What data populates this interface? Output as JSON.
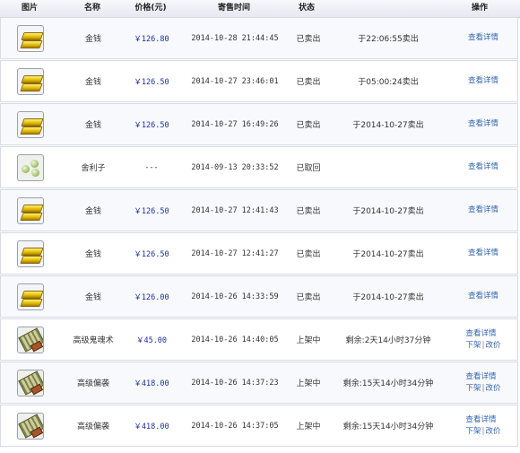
{
  "header": {
    "image": "图片",
    "name": "名称",
    "price": "价格(元)",
    "time": "寄售时间",
    "status": "状态",
    "ops": "操作"
  },
  "rows": [
    {
      "icon": "gold-ingot-icon",
      "name": "金钱",
      "price": "￥126.80",
      "time": "2014-10-28 21:44:45",
      "status": "已卖出",
      "desc": "于22:06:55卖出",
      "ops": [
        "查看详情"
      ]
    },
    {
      "icon": "gold-ingot-icon",
      "name": "金钱",
      "price": "￥126.50",
      "time": "2014-10-27 23:46:01",
      "status": "已卖出",
      "desc": "于05:00:24卖出",
      "ops": [
        "查看详情"
      ]
    },
    {
      "icon": "gold-ingot-icon",
      "name": "金钱",
      "price": "￥126.50",
      "time": "2014-10-27 16:49:26",
      "status": "已卖出",
      "desc": "于2014-10-27卖出",
      "ops": [
        "查看详情"
      ]
    },
    {
      "icon": "relic-beads-icon",
      "name": "舍利子",
      "price": "---",
      "time": "2014-09-13 20:33:52",
      "status": "已取回",
      "desc": "",
      "ops": [
        "查看详情"
      ]
    },
    {
      "icon": "gold-ingot-icon",
      "name": "金钱",
      "price": "￥126.50",
      "time": "2014-10-27 12:41:43",
      "status": "已卖出",
      "desc": "于2014-10-27卖出",
      "ops": [
        "查看详情"
      ]
    },
    {
      "icon": "gold-ingot-icon",
      "name": "金钱",
      "price": "￥126.50",
      "time": "2014-10-27 12:41:27",
      "status": "已卖出",
      "desc": "于2014-10-27卖出",
      "ops": [
        "查看详情"
      ]
    },
    {
      "icon": "gold-ingot-icon",
      "name": "金钱",
      "price": "￥126.00",
      "time": "2014-10-26 14:33:59",
      "status": "已卖出",
      "desc": "于2014-10-27卖出",
      "ops": [
        "查看详情"
      ]
    },
    {
      "icon": "scroll-item-icon",
      "name": "高级鬼魂术",
      "price": "￥45.00",
      "time": "2014-10-26 14:40:05",
      "status": "上架中",
      "desc": "剩余:2天14小时37分钟",
      "ops": [
        "查看详情",
        "下架",
        "改价"
      ]
    },
    {
      "icon": "scroll-item-icon",
      "name": "高级偏袭",
      "price": "￥418.00",
      "time": "2014-10-26 14:37:23",
      "status": "上架中",
      "desc": "剩余:15天14小时34分钟",
      "ops": [
        "查看详情",
        "下架",
        "改价"
      ]
    },
    {
      "icon": "scroll-item-icon",
      "name": "高级偏袭",
      "price": "￥418.00",
      "time": "2014-10-26 14:37:05",
      "status": "上架中",
      "desc": "剩余:15天14小时34分钟",
      "ops": [
        "查看详情",
        "下架",
        "改价"
      ]
    }
  ]
}
